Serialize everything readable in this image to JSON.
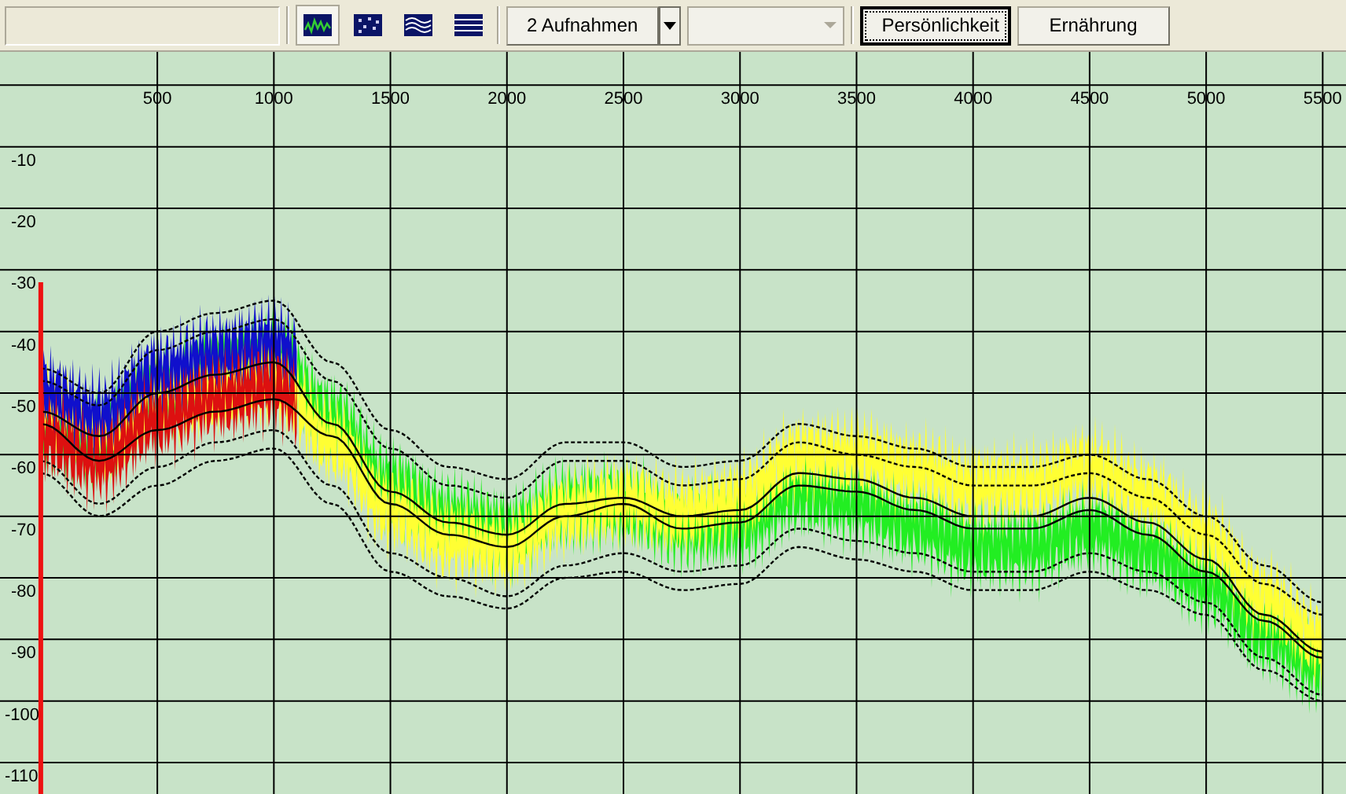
{
  "toolbar": {
    "view_buttons": [
      {
        "kind": "waveform",
        "selected": true
      },
      {
        "kind": "scatter",
        "selected": false
      },
      {
        "kind": "bands",
        "selected": false
      },
      {
        "kind": "list",
        "selected": false
      }
    ],
    "recordings": {
      "label": "2 Aufnahmen"
    },
    "buttons": [
      {
        "label": "Persönlichkeit",
        "selected": true
      },
      {
        "label": "Ernährung",
        "selected": false
      }
    ]
  },
  "chart": {
    "chart_data": {
      "type": "line",
      "x": [
        0,
        250,
        500,
        750,
        1000,
        1250,
        1500,
        1750,
        2000,
        2250,
        2500,
        2750,
        3000,
        3250,
        3500,
        3750,
        4000,
        4250,
        4500,
        4750,
        5000,
        5250,
        5500
      ],
      "xlim": [
        -175,
        5600
      ],
      "ylim": [
        -115.1,
        5.4
      ],
      "grid": true,
      "xticks": [
        500,
        1000,
        1500,
        2000,
        2500,
        3000,
        3500,
        4000,
        4500,
        5000,
        5500
      ],
      "yticks": [
        -10,
        -20,
        -30,
        -40,
        -50,
        -60,
        -70,
        -80,
        -90,
        -100,
        -110
      ],
      "series": [
        {
          "color": "#000000",
          "line_style": "solid",
          "values": [
            -53,
            -57,
            -50,
            -47,
            -45,
            -55,
            -66,
            -71,
            -73,
            -68,
            -67,
            -70,
            -69,
            -63,
            -64,
            -67,
            -70,
            -70,
            -67,
            -71,
            -77,
            -86,
            -92
          ]
        },
        {
          "color": "#000000",
          "line_style": "solid",
          "values": [
            -55,
            -61,
            -56,
            -53,
            -51,
            -57,
            -68,
            -73,
            -75,
            -70,
            -68,
            -72,
            -71,
            -65,
            -66,
            -69,
            -72,
            -72,
            -69,
            -73,
            -79,
            -87,
            -93
          ]
        },
        {
          "color": "#000000",
          "line_style": "dashed",
          "values": [
            -46,
            -50,
            -40,
            -37,
            -35,
            -45,
            -56,
            -62,
            -64,
            -58,
            -58,
            -62,
            -61,
            -55,
            -57,
            -59,
            -62,
            -62,
            -60,
            -64,
            -70,
            -78,
            -84
          ]
        },
        {
          "color": "#000000",
          "line_style": "dashed",
          "values": [
            -48,
            -52,
            -43,
            -40,
            -38,
            -48,
            -59,
            -65,
            -67,
            -61,
            -61,
            -65,
            -64,
            -58,
            -60,
            -62,
            -65,
            -65,
            -63,
            -67,
            -73,
            -81,
            -86
          ]
        },
        {
          "color": "#000000",
          "line_style": "dashed",
          "values": [
            -61,
            -68,
            -62,
            -58,
            -56,
            -65,
            -76,
            -80,
            -83,
            -78,
            -76,
            -79,
            -78,
            -72,
            -74,
            -76,
            -79,
            -79,
            -76,
            -79,
            -84,
            -93,
            -99
          ]
        },
        {
          "color": "#000000",
          "line_style": "dashed",
          "values": [
            -63,
            -70,
            -65,
            -61,
            -59,
            -68,
            -79,
            -83,
            -85,
            -80,
            -79,
            -82,
            -81,
            -75,
            -77,
            -79,
            -82,
            -82,
            -79,
            -82,
            -86,
            -95,
            -100
          ]
        }
      ]
    }
  }
}
